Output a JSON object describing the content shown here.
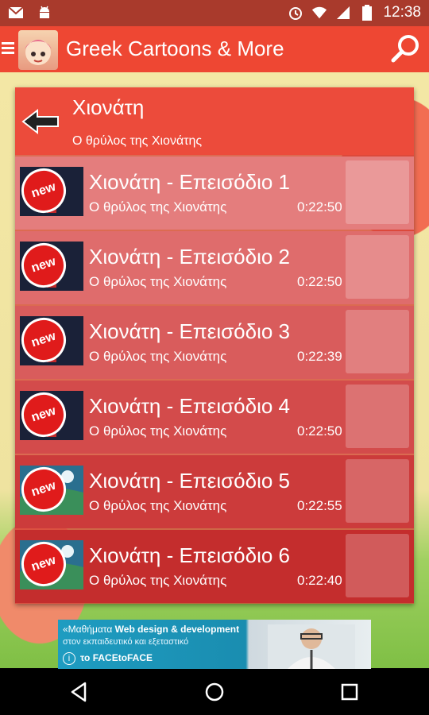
{
  "status_bar": {
    "time": "12:38",
    "left_icons": [
      "gmail-icon",
      "android-icon"
    ],
    "right_icons": [
      "alarm-icon",
      "wifi-icon",
      "signal-icon",
      "battery-icon"
    ]
  },
  "app_bar": {
    "title": "Greek Cartoons & More",
    "menu_icon": "menu-icon",
    "search_icon": "search-icon"
  },
  "header": {
    "title": "Χιονάτη",
    "subtitle": "Ο θρύλος της Χιονάτης"
  },
  "episodes": [
    {
      "badge": "new",
      "title": "Χιονάτη - Επεισόδιο 1",
      "subtitle": "Ο θρύλος της Χιονάτης",
      "duration": "0:22:50",
      "bg": "#e47d7d"
    },
    {
      "badge": "new",
      "title": "Χιονάτη - Επεισόδιο 2",
      "subtitle": "Ο θρύλος της Χιονάτης",
      "duration": "0:22:50",
      "bg": "#df6c6c"
    },
    {
      "badge": "new",
      "title": "Χιονάτη - Επεισόδιο 3",
      "subtitle": "Ο θρύλος της Χιονάτης",
      "duration": "0:22:39",
      "bg": "#d95c5c"
    },
    {
      "badge": "new",
      "title": "Χιονάτη - Επεισόδιο 4",
      "subtitle": "Ο θρύλος της Χιονάτης",
      "duration": "0:22:50",
      "bg": "#d34b4b"
    },
    {
      "badge": "new",
      "title": "Χιονάτη - Επεισόδιο 5",
      "subtitle": "Ο θρύλος της Χιονάτης",
      "duration": "0:22:55",
      "bg": "#cc3b3b"
    },
    {
      "badge": "new",
      "title": "Χιονάτη - Επεισόδιο 6",
      "subtitle": "Ο θρύλος της Χιονάτης",
      "duration": "0:22:40",
      "bg": "#c42d2d"
    }
  ],
  "ad": {
    "line1_prefix": "«Μαθήματα ",
    "line1_bold": "Web design & development",
    "line2": "στον εκπαιδευτικό και εξεταστικό",
    "line3_prefix": "το ",
    "line3_brand": "FACEtoFACE",
    "info_label": "i"
  },
  "nav_bar": {
    "buttons": [
      "back-icon",
      "home-icon",
      "recents-icon"
    ]
  },
  "colors": {
    "status_bar": "#a93a2c",
    "app_bar": "#ee4733",
    "panel_header": "#ec4b3b",
    "badge": "#e01b1b"
  }
}
